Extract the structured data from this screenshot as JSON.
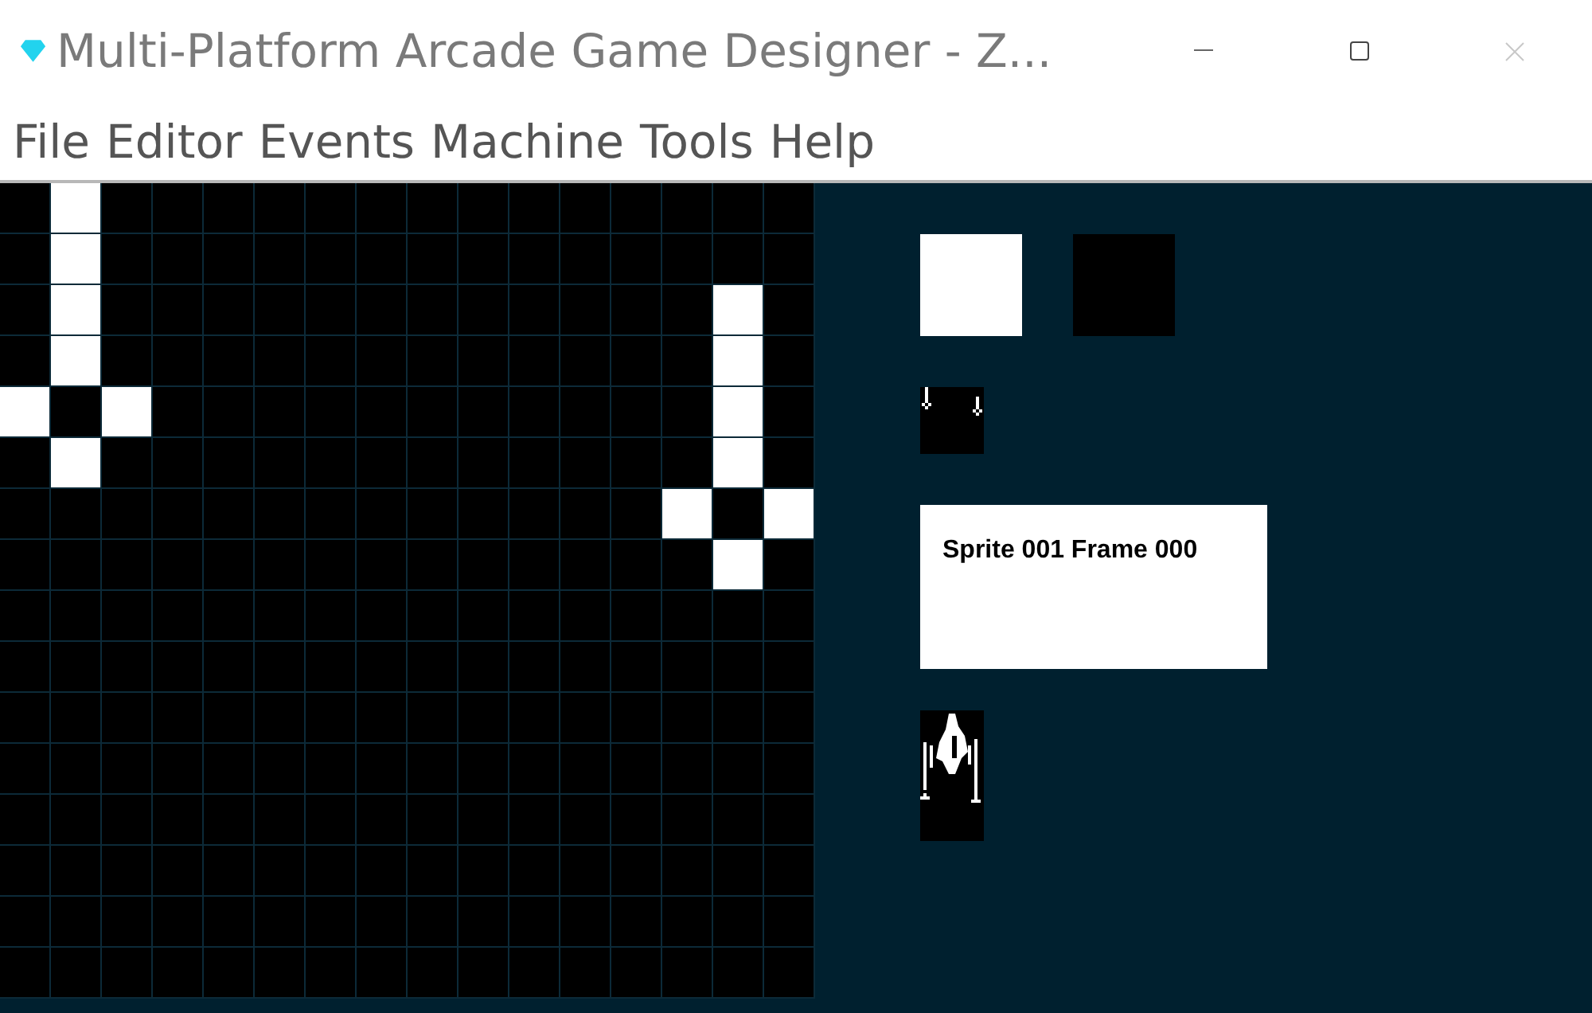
{
  "window": {
    "title": "Multi-Platform Arcade Game Designer - Z..."
  },
  "menu": [
    "File",
    "Editor",
    "Events",
    "Machine",
    "Tools",
    "Help"
  ],
  "pixel_grid": {
    "rows": [
      [
        {
          "on": false
        },
        {
          "on": true
        },
        {
          "on": false
        },
        {
          "on": false
        },
        {
          "on": false
        },
        {
          "on": false
        },
        {
          "on": false
        },
        {
          "on": false
        },
        {
          "on": false
        },
        {
          "on": false
        },
        {
          "on": false
        },
        {
          "on": false
        },
        {
          "on": false
        },
        {
          "on": false
        },
        {
          "on": false
        },
        {
          "on": false
        }
      ],
      [
        {
          "on": false
        },
        {
          "on": true
        },
        {
          "on": false
        },
        {
          "on": false
        },
        {
          "on": false
        },
        {
          "on": false
        },
        {
          "on": false
        },
        {
          "on": false
        },
        {
          "on": false
        },
        {
          "on": false
        },
        {
          "on": false
        },
        {
          "on": false
        },
        {
          "on": false
        },
        {
          "on": false
        },
        {
          "on": false
        },
        {
          "on": false
        }
      ],
      [
        {
          "on": false
        },
        {
          "on": true
        },
        {
          "on": false
        },
        {
          "on": false
        },
        {
          "on": false
        },
        {
          "on": false
        },
        {
          "on": false
        },
        {
          "on": false
        },
        {
          "on": false
        },
        {
          "on": false
        },
        {
          "on": false
        },
        {
          "on": false
        },
        {
          "on": false
        },
        {
          "on": false
        },
        {
          "on": true
        },
        {
          "on": false
        }
      ],
      [
        {
          "on": false
        },
        {
          "on": true
        },
        {
          "on": false
        },
        {
          "on": false
        },
        {
          "on": false
        },
        {
          "on": false
        },
        {
          "on": false
        },
        {
          "on": false
        },
        {
          "on": false
        },
        {
          "on": false
        },
        {
          "on": false
        },
        {
          "on": false
        },
        {
          "on": false
        },
        {
          "on": false
        },
        {
          "on": true
        },
        {
          "on": false
        }
      ],
      [
        {
          "on": true
        },
        {
          "on": false
        },
        {
          "on": true
        },
        {
          "on": false
        },
        {
          "on": false
        },
        {
          "on": false
        },
        {
          "on": false
        },
        {
          "on": false
        },
        {
          "on": false
        },
        {
          "on": false
        },
        {
          "on": false
        },
        {
          "on": false
        },
        {
          "on": false
        },
        {
          "on": false
        },
        {
          "on": true
        },
        {
          "on": false
        }
      ],
      [
        {
          "on": false
        },
        {
          "on": true
        },
        {
          "on": false
        },
        {
          "on": false
        },
        {
          "on": false
        },
        {
          "on": false
        },
        {
          "on": false
        },
        {
          "on": false
        },
        {
          "on": false
        },
        {
          "on": false
        },
        {
          "on": false
        },
        {
          "on": false
        },
        {
          "on": false
        },
        {
          "on": false
        },
        {
          "on": true
        },
        {
          "on": false
        }
      ],
      [
        {
          "on": false
        },
        {
          "on": false
        },
        {
          "on": false
        },
        {
          "on": false
        },
        {
          "on": false
        },
        {
          "on": false
        },
        {
          "on": false
        },
        {
          "on": false
        },
        {
          "on": false
        },
        {
          "on": false
        },
        {
          "on": false
        },
        {
          "on": false
        },
        {
          "on": false
        },
        {
          "on": true
        },
        {
          "on": false
        },
        {
          "on": true
        }
      ],
      [
        {
          "on": false
        },
        {
          "on": false
        },
        {
          "on": false
        },
        {
          "on": false
        },
        {
          "on": false
        },
        {
          "on": false
        },
        {
          "on": false
        },
        {
          "on": false
        },
        {
          "on": false
        },
        {
          "on": false
        },
        {
          "on": false
        },
        {
          "on": false
        },
        {
          "on": false
        },
        {
          "on": false
        },
        {
          "on": true
        },
        {
          "on": false
        }
      ],
      [
        {
          "on": false
        },
        {
          "on": false
        },
        {
          "on": false
        },
        {
          "on": false
        },
        {
          "on": false
        },
        {
          "on": false
        },
        {
          "on": false
        },
        {
          "on": false
        },
        {
          "on": false
        },
        {
          "on": false
        },
        {
          "on": false
        },
        {
          "on": false
        },
        {
          "on": false
        },
        {
          "on": false
        },
        {
          "on": false
        },
        {
          "on": false
        }
      ],
      [
        {
          "on": false
        },
        {
          "on": false
        },
        {
          "on": false
        },
        {
          "on": false
        },
        {
          "on": false
        },
        {
          "on": false
        },
        {
          "on": false
        },
        {
          "on": false
        },
        {
          "on": false
        },
        {
          "on": false
        },
        {
          "on": false
        },
        {
          "on": false
        },
        {
          "on": false
        },
        {
          "on": false
        },
        {
          "on": false
        },
        {
          "on": false
        }
      ],
      [
        {
          "on": false
        },
        {
          "on": false
        },
        {
          "on": false
        },
        {
          "on": false
        },
        {
          "on": false
        },
        {
          "on": false
        },
        {
          "on": false
        },
        {
          "on": false
        },
        {
          "on": false
        },
        {
          "on": false
        },
        {
          "on": false
        },
        {
          "on": false
        },
        {
          "on": false
        },
        {
          "on": false
        },
        {
          "on": false
        },
        {
          "on": false
        }
      ],
      [
        {
          "on": false
        },
        {
          "on": false
        },
        {
          "on": false
        },
        {
          "on": false
        },
        {
          "on": false
        },
        {
          "on": false
        },
        {
          "on": false
        },
        {
          "on": false
        },
        {
          "on": false
        },
        {
          "on": false
        },
        {
          "on": false
        },
        {
          "on": false
        },
        {
          "on": false
        },
        {
          "on": false
        },
        {
          "on": false
        },
        {
          "on": false
        }
      ],
      [
        {
          "on": false
        },
        {
          "on": false
        },
        {
          "on": false
        },
        {
          "on": false
        },
        {
          "on": false
        },
        {
          "on": false
        },
        {
          "on": false
        },
        {
          "on": false
        },
        {
          "on": false
        },
        {
          "on": false
        },
        {
          "on": false
        },
        {
          "on": false
        },
        {
          "on": false
        },
        {
          "on": false
        },
        {
          "on": false
        },
        {
          "on": false
        }
      ],
      [
        {
          "on": false
        },
        {
          "on": false
        },
        {
          "on": false
        },
        {
          "on": false
        },
        {
          "on": false
        },
        {
          "on": false
        },
        {
          "on": false
        },
        {
          "on": false
        },
        {
          "on": false
        },
        {
          "on": false
        },
        {
          "on": false
        },
        {
          "on": false
        },
        {
          "on": false
        },
        {
          "on": false
        },
        {
          "on": false
        },
        {
          "on": false
        }
      ],
      [
        {
          "on": false
        },
        {
          "on": false
        },
        {
          "on": false
        },
        {
          "on": false
        },
        {
          "on": false
        },
        {
          "on": false
        },
        {
          "on": false
        },
        {
          "on": false
        },
        {
          "on": false
        },
        {
          "on": false
        },
        {
          "on": false
        },
        {
          "on": false
        },
        {
          "on": false
        },
        {
          "on": false
        },
        {
          "on": false
        },
        {
          "on": false
        }
      ],
      [
        {
          "on": false
        },
        {
          "on": false
        },
        {
          "on": false
        },
        {
          "on": false
        },
        {
          "on": false
        },
        {
          "on": false
        },
        {
          "on": false
        },
        {
          "on": false
        },
        {
          "on": false
        },
        {
          "on": false
        },
        {
          "on": false
        },
        {
          "on": false
        },
        {
          "on": false
        },
        {
          "on": false
        },
        {
          "on": false
        },
        {
          "on": false
        }
      ]
    ]
  },
  "palette": [
    {
      "color": "#ffffff"
    },
    {
      "color": "#000000"
    }
  ],
  "info": {
    "text": "Sprite 001 Frame 000"
  }
}
